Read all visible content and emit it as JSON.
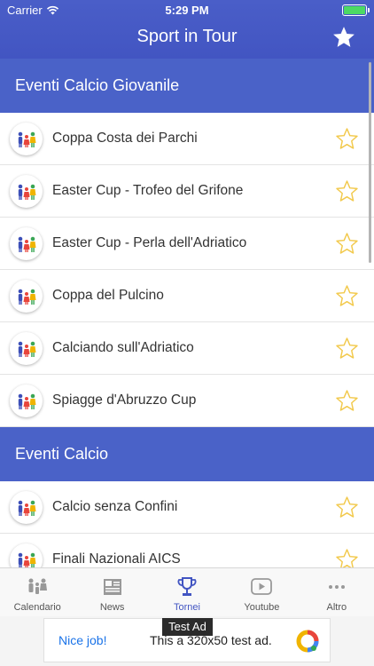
{
  "status_bar": {
    "carrier": "Carrier",
    "time": "5:29 PM",
    "battery_level": 1.0
  },
  "app": {
    "title": "Sport in Tour"
  },
  "sections": [
    {
      "title": "Eventi Calcio Giovanile",
      "items": [
        {
          "label": "Coppa Costa dei Parchi"
        },
        {
          "label": "Easter Cup - Trofeo del Grifone"
        },
        {
          "label": "Easter Cup - Perla dell'Adriatico"
        },
        {
          "label": "Coppa del Pulcino"
        },
        {
          "label": "Calciando sull'Adriatico"
        },
        {
          "label": "Spiagge d'Abruzzo Cup"
        }
      ]
    },
    {
      "title": "Eventi Calcio",
      "items": [
        {
          "label": "Calcio senza Confini"
        },
        {
          "label": "Finali Nazionali AICS"
        }
      ]
    }
  ],
  "tabs": [
    {
      "label": "Calendario",
      "icon": "family-icon"
    },
    {
      "label": "News",
      "icon": "newspaper-icon"
    },
    {
      "label": "Tornei",
      "icon": "trophy-icon",
      "active": true
    },
    {
      "label": "Youtube",
      "icon": "play-icon"
    },
    {
      "label": "Altro",
      "icon": "more-icon"
    }
  ],
  "tooltip": "Test Ad",
  "ad": {
    "nice": "Nice job!",
    "text": "This a 320x50 test ad."
  },
  "colors": {
    "header": "#4255c2",
    "section": "#4a62c8",
    "star": "#f2c94c",
    "active_tab": "#4255c2"
  }
}
